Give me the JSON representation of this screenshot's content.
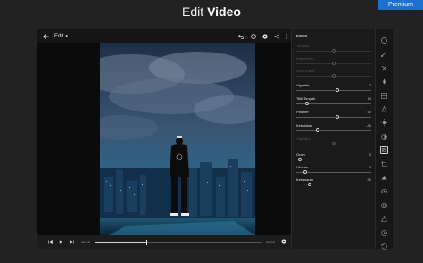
{
  "premium_label": "Premium",
  "title": {
    "normal": "Edit ",
    "bold": "Video"
  },
  "toolbar": {
    "menu_label": "Edit"
  },
  "playback": {
    "current_time": "00:00",
    "end_time": "00:00",
    "progress": 0.31
  },
  "panel": {
    "header": "EFEK",
    "sliders": [
      {
        "label": "Tindaan",
        "value": "",
        "position": 0.5,
        "enabled": false
      },
      {
        "label": "Kejernihan",
        "value": "",
        "position": 0.5,
        "enabled": false
      },
      {
        "label": "Lihat Kabut",
        "value": "",
        "position": 0.5,
        "enabled": false
      },
      {
        "label": "Vignette",
        "value": "7",
        "position": 0.55,
        "enabled": true
      },
      {
        "label": "Titik Tengah",
        "value": "14",
        "position": 0.14,
        "enabled": true
      },
      {
        "label": "Feather",
        "value": "50",
        "position": 0.55,
        "enabled": true
      },
      {
        "label": "Kebulatan",
        "value": "-45",
        "position": 0.28,
        "enabled": true
      },
      {
        "label": "Highlight",
        "value": "",
        "position": 0.5,
        "enabled": false
      },
      {
        "label": "Grain",
        "value": "0",
        "position": 0.05,
        "enabled": true
      },
      {
        "label": "Ukuran",
        "value": "0",
        "position": 0.12,
        "enabled": true
      },
      {
        "label": "Kekasaran",
        "value": "50",
        "position": 0.18,
        "enabled": true
      }
    ]
  },
  "rail_icons": [
    "circle-icon",
    "brush-icon",
    "heal-icon",
    "drop-icon",
    "gradient-icon",
    "light-icon",
    "sun-icon",
    "adjust-icon",
    "vignette-icon",
    "crop-icon",
    "detail-icon",
    "eye-icon",
    "filter-icon",
    "color-icon",
    "history-icon",
    "reset-icon"
  ],
  "rail_active_index": 8
}
